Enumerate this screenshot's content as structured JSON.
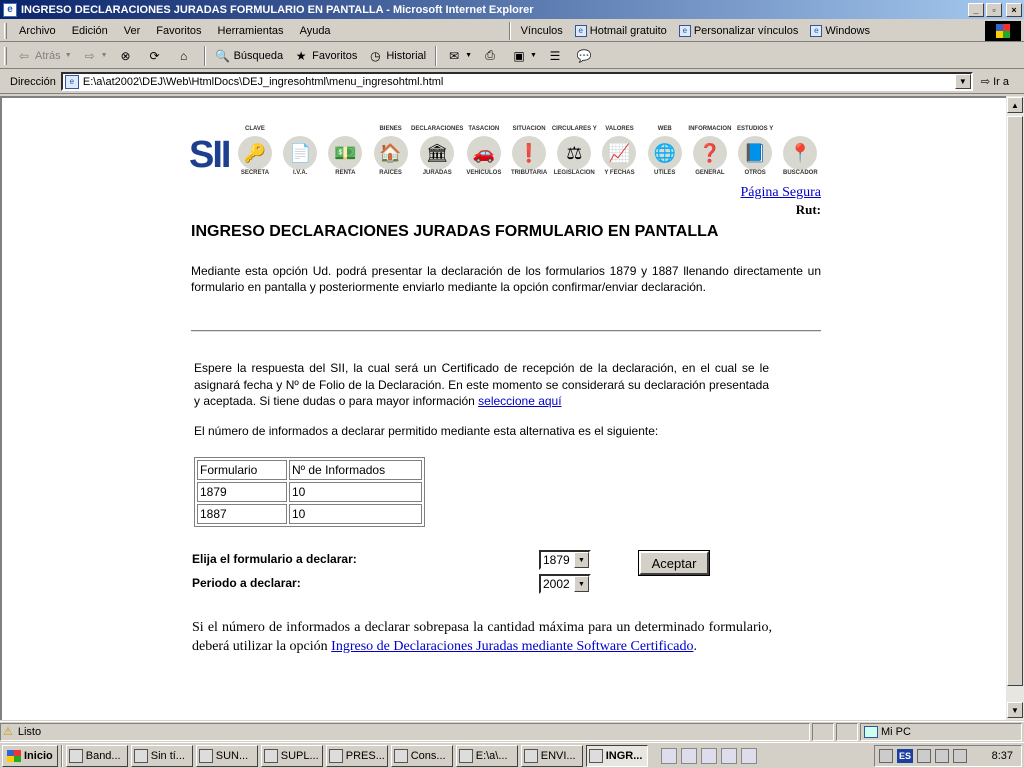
{
  "window": {
    "title": "INGRESO DECLARACIONES JURADAS FORMULARIO EN PANTALLA - Microsoft Internet Explorer",
    "buttons": [
      "_",
      "▫",
      "×"
    ]
  },
  "menu": {
    "items": [
      "Archivo",
      "Edición",
      "Ver",
      "Favoritos",
      "Herramientas",
      "Ayuda"
    ],
    "links_label": "Vínculos",
    "links": [
      "Hotmail gratuito",
      "Personalizar vínculos",
      "Windows"
    ]
  },
  "toolbar": {
    "back": "Atrás",
    "search": "Búsqueda",
    "favorites": "Favoritos",
    "history": "Historial"
  },
  "address": {
    "label": "Dirección",
    "url": "E:\\a\\at2002\\DEJ\\Web\\HtmlDocs\\DEJ_ingresohtml\\menu_ingresohtml.html",
    "go": "Ir a"
  },
  "banner": {
    "logo": "SII",
    "items": [
      {
        "top": "CLAVE",
        "bottom": "SECRETA",
        "icon": "🔑"
      },
      {
        "top": "",
        "bottom": "I.V.A.",
        "icon": "📄"
      },
      {
        "top": "",
        "bottom": "RENTA",
        "icon": "💵"
      },
      {
        "top": "BIENES",
        "bottom": "RAICES",
        "icon": "🏠"
      },
      {
        "top": "DECLARACIONES",
        "bottom": "JURADAS",
        "icon": "🏛"
      },
      {
        "top": "TASACION",
        "bottom": "VEHICULOS",
        "icon": "🚗"
      },
      {
        "top": "SITUACION",
        "bottom": "TRIBUTARIA",
        "icon": "❗"
      },
      {
        "top": "CIRCULARES Y",
        "bottom": "LEGISLACION",
        "icon": "⚖"
      },
      {
        "top": "VALORES",
        "bottom": "Y FECHAS",
        "icon": "📈"
      },
      {
        "top": "WEB",
        "bottom": "UTILES",
        "icon": "🌐"
      },
      {
        "top": "INFORMACION",
        "bottom": "GENERAL",
        "icon": "❓"
      },
      {
        "top": "ESTUDIOS Y",
        "bottom": "OTROS",
        "icon": "📘"
      },
      {
        "top": "",
        "bottom": "BUSCADOR",
        "icon": "📍"
      }
    ]
  },
  "page": {
    "secure_link": "Página Segura",
    "rut_label": "Rut:",
    "title": "INGRESO DECLARACIONES JURADAS FORMULARIO EN PANTALLA",
    "intro": "Mediante esta opción Ud. podrá presentar la declaración de los formularios 1879 y 1887 llenando directamente un formulario en pantalla y posteriormente enviarlo mediante la opción confirmar/enviar declaración.",
    "para2": "Espere la respuesta del SII, la cual será un Certificado de recepción de la declaración, en el cual se le asignará fecha y Nº de Folio de la Declaración. En este momento se considerará su declaración presentada y aceptada. Si tiene dudas o para mayor información ",
    "para2_link": "seleccione aquí",
    "para3": "El número de informados a declarar permitido mediante esta alternativa es el siguiente:",
    "table": {
      "headers": [
        "Formulario",
        "Nº de Informados"
      ],
      "rows": [
        [
          "1879",
          "10"
        ],
        [
          "1887",
          "10"
        ]
      ]
    },
    "form": {
      "form_label": "Elija el formulario a declarar:",
      "form_value": "1879",
      "period_label": "Periodo a declarar:",
      "period_value": "2002",
      "accept": "Aceptar"
    },
    "final_text": "Si el número de informados a declarar sobrepasa la cantidad máxima para un determinado formulario, deberá utilizar la opción ",
    "final_link": "Ingreso de Declaraciones Juradas mediante Software Certificado",
    "final_end": "."
  },
  "status": {
    "text": "Listo",
    "zone": "Mi PC"
  },
  "taskbar": {
    "start": "Inicio",
    "tasks": [
      "Band...",
      "Sin tí...",
      "SUN...",
      "SUPL...",
      "PRES...",
      "Cons...",
      "E:\\a\\...",
      "ENVI...",
      "INGR..."
    ],
    "lang": "ES",
    "clock": "8:37"
  }
}
